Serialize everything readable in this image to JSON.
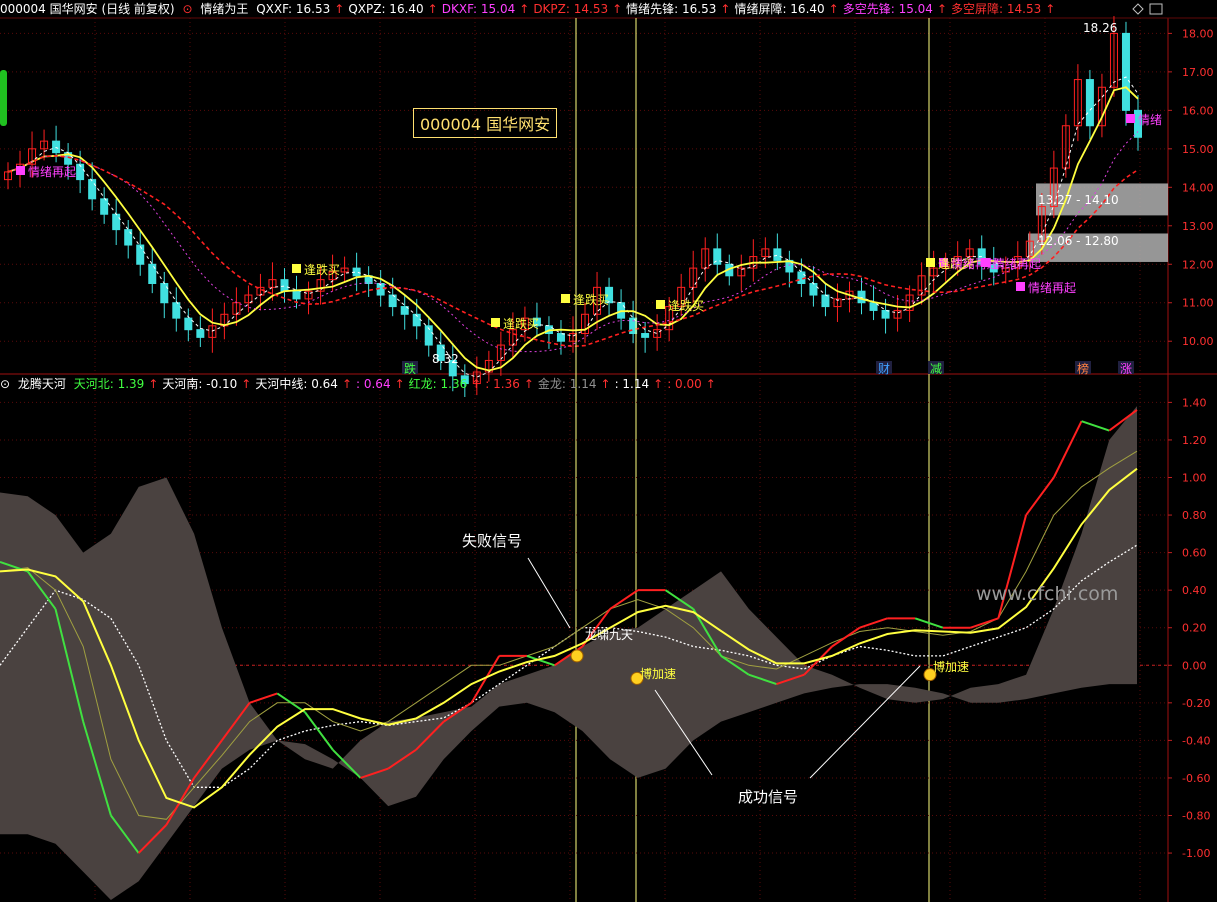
{
  "top_header": {
    "symbol": "000004 国华网安 (日线 前复权)",
    "indicator": "情绪为王",
    "items": [
      {
        "label": "QXXF: 16.53",
        "color": "#ffffff"
      },
      {
        "label": "QXPZ: 16.40",
        "color": "#ffffff"
      },
      {
        "label": "DKXF: 15.04",
        "color": "#ff40ff"
      },
      {
        "label": "DKPZ: 14.53",
        "color": "#ff3030"
      },
      {
        "label": "情绪先锋: 16.53",
        "color": "#ffffff"
      },
      {
        "label": "情绪屏障: 16.40",
        "color": "#ffffff"
      },
      {
        "label": "多空先锋: 15.04",
        "color": "#ff40ff"
      },
      {
        "label": "多空屏障: 14.53",
        "color": "#ff3030"
      }
    ]
  },
  "bottom_header": {
    "name": "龙腾天河",
    "items": [
      {
        "label": "天河北: 1.39",
        "color": "#40ff40"
      },
      {
        "label": "天河南: -0.10",
        "color": "#ffffff"
      },
      {
        "label": "天河中线: 0.64",
        "color": "#ffffff"
      },
      {
        "label": ": 0.64",
        "color": "#ff40ff"
      },
      {
        "label": "红龙: 1.36",
        "color": "#40ff40"
      },
      {
        "label": ": 1.36",
        "color": "#ff3030"
      },
      {
        "label": "金龙: 1.14",
        "color": "#909090"
      },
      {
        "label": ": 1.14",
        "color": "#ffffff"
      },
      {
        "label": ": 0.00",
        "color": "#ff3030"
      }
    ]
  },
  "stock_label": "000004 国华网安",
  "watermark": "www.cfchi.com",
  "annotations": {
    "fail_signal": "失败信号",
    "success_signal": "成功信号",
    "long_xiao": "龙啸九天",
    "bo_jiasu_1": "博加速",
    "bo_jiasu_2": "博加速",
    "price_high": "18.26",
    "price_low": "8.32",
    "zone_upper": "13.27 - 14.10",
    "zone_lower": "12.06 - 12.80"
  },
  "top_markers": [
    {
      "text": "情绪再起",
      "color": "#ff40ff"
    },
    {
      "text": "逢跌买",
      "color": "#ffff40"
    },
    {
      "text": "逢跌买",
      "color": "#ffff40"
    },
    {
      "text": "逢跌买",
      "color": "#ffff40"
    },
    {
      "text": "逢跌买",
      "color": "#ffff40"
    },
    {
      "text": "逢跌买",
      "color": "#ffff40"
    },
    {
      "text": "情绪再起",
      "color": "#ff40ff"
    },
    {
      "text": "情绪再起",
      "color": "#ff40ff"
    },
    {
      "text": "情绪再起",
      "color": "#ff40ff"
    },
    {
      "text": "情绪",
      "color": "#ff40ff"
    }
  ],
  "bottom_labels": [
    {
      "text": "跌",
      "color": "#40ff40"
    },
    {
      "text": "财",
      "color": "#40a0ff"
    },
    {
      "text": "减",
      "color": "#40ff40"
    },
    {
      "text": "榜",
      "color": "#ff8040"
    },
    {
      "text": "涨",
      "color": "#ff40ff"
    }
  ],
  "colors": {
    "up": "#ff2020",
    "down": "#40e0e0",
    "ma_white": "#ffffff",
    "ma_yellow": "#ffff40",
    "ma_red": "#ff2020",
    "ma_magenta": "#e040e0",
    "band": "#4a4240"
  },
  "chart_data": [
    {
      "type": "candlestick",
      "title": "000004 国华网安 (日线 前复权)",
      "ylim": [
        9.2,
        18.4
      ],
      "y_ticks": [
        10.0,
        11.0,
        12.0,
        13.0,
        14.0,
        15.0,
        16.0,
        17.0,
        18.0
      ],
      "close": [
        14.4,
        14.6,
        15.0,
        15.2,
        14.9,
        14.6,
        14.2,
        13.7,
        13.3,
        12.9,
        12.5,
        12.0,
        11.5,
        11.0,
        10.6,
        10.3,
        10.1,
        10.4,
        10.7,
        11.0,
        11.2,
        11.4,
        11.6,
        11.3,
        11.1,
        11.3,
        11.6,
        11.8,
        11.9,
        11.7,
        11.5,
        11.2,
        10.9,
        10.7,
        10.4,
        9.9,
        9.5,
        9.1,
        8.9,
        9.2,
        9.5,
        9.9,
        10.3,
        10.6,
        10.4,
        10.2,
        10.0,
        10.2,
        10.7,
        11.4,
        11.0,
        10.6,
        10.2,
        10.1,
        10.3,
        10.9,
        11.4,
        11.9,
        12.4,
        12.0,
        11.7,
        11.9,
        12.2,
        12.4,
        12.1,
        11.8,
        11.5,
        11.2,
        10.9,
        11.1,
        11.3,
        11.0,
        10.8,
        10.6,
        10.8,
        11.2,
        11.7,
        11.9,
        12.0,
        12.2,
        12.4,
        12.0,
        11.8,
        11.9,
        12.2,
        12.6,
        13.5,
        14.5,
        15.6,
        16.8,
        15.6,
        16.6,
        18.0,
        16.0,
        15.3
      ],
      "annotations": [
        "18.26",
        "8.32",
        "13.27 - 14.10",
        "12.06 - 12.80"
      ]
    },
    {
      "type": "line",
      "title": "龙腾天河",
      "ylim": [
        -1.25,
        1.45
      ],
      "y_ticks": [
        1.4,
        1.2,
        1.0,
        0.8,
        0.6,
        0.4,
        0.2,
        0.0,
        -0.2,
        -0.4,
        -0.6,
        -0.8,
        -1.0
      ],
      "series": [
        {
          "name": "天河北",
          "values": [
            0.92,
            0.9,
            0.8,
            0.6,
            0.7,
            0.95,
            1.0,
            0.7,
            0.2,
            -0.2,
            -0.4,
            -0.5,
            -0.55,
            -0.4,
            -0.3,
            -0.28,
            -0.25,
            -0.22,
            -0.1,
            -0.05,
            0.0,
            0.1,
            0.18,
            0.2,
            0.3,
            0.4,
            0.5,
            0.3,
            0.15,
            0.0,
            -0.05,
            -0.12,
            -0.18,
            -0.2,
            -0.18,
            -0.12,
            -0.1,
            -0.05,
            0.3,
            0.7,
            1.2,
            1.38
          ]
        },
        {
          "name": "天河南",
          "values": [
            -0.9,
            -0.9,
            -0.95,
            -1.1,
            -1.25,
            -1.15,
            -0.95,
            -0.75,
            -0.55,
            -0.45,
            -0.4,
            -0.42,
            -0.5,
            -0.6,
            -0.75,
            -0.7,
            -0.5,
            -0.35,
            -0.22,
            -0.2,
            -0.25,
            -0.35,
            -0.5,
            -0.6,
            -0.55,
            -0.4,
            -0.3,
            -0.25,
            -0.2,
            -0.15,
            -0.12,
            -0.1,
            -0.1,
            -0.12,
            -0.15,
            -0.2,
            -0.2,
            -0.18,
            -0.15,
            -0.12,
            -0.1,
            -0.1
          ]
        },
        {
          "name": "天河中线",
          "values": [
            0.0,
            0.2,
            0.4,
            0.35,
            0.25,
            0.0,
            -0.4,
            -0.65,
            -0.65,
            -0.55,
            -0.4,
            -0.35,
            -0.32,
            -0.3,
            -0.32,
            -0.3,
            -0.28,
            -0.2,
            -0.1,
            0.0,
            0.1,
            0.2,
            0.2,
            0.18,
            0.15,
            0.1,
            0.08,
            0.05,
            0.0,
            -0.02,
            0.05,
            0.1,
            0.08,
            0.05,
            0.05,
            0.1,
            0.15,
            0.2,
            0.3,
            0.45,
            0.55,
            0.64
          ]
        },
        {
          "name": "红龙",
          "values": [
            0.55,
            0.5,
            0.3,
            -0.3,
            -0.8,
            -1.0,
            -0.85,
            -0.6,
            -0.4,
            -0.2,
            -0.15,
            -0.25,
            -0.45,
            -0.6,
            -0.55,
            -0.45,
            -0.3,
            -0.2,
            0.05,
            0.05,
            0.0,
            0.1,
            0.3,
            0.4,
            0.4,
            0.3,
            0.05,
            -0.05,
            -0.1,
            -0.05,
            0.1,
            0.2,
            0.25,
            0.25,
            0.2,
            0.2,
            0.25,
            0.8,
            1.0,
            1.3,
            1.25,
            1.36
          ]
        },
        {
          "name": "金龙",
          "values": [
            0.5,
            0.52,
            0.4,
            0.1,
            -0.5,
            -0.8,
            -0.82,
            -0.65,
            -0.48,
            -0.3,
            -0.2,
            -0.2,
            -0.3,
            -0.35,
            -0.3,
            -0.2,
            -0.1,
            0.0,
            0.0,
            0.05,
            0.1,
            0.2,
            0.3,
            0.35,
            0.3,
            0.2,
            0.05,
            0.0,
            -0.02,
            0.05,
            0.12,
            0.18,
            0.2,
            0.18,
            0.16,
            0.18,
            0.25,
            0.5,
            0.8,
            0.95,
            1.05,
            1.14
          ]
        }
      ],
      "annotations": [
        "失败信号",
        "成功信号",
        "龙啸九天",
        "博加速",
        "博加速"
      ]
    }
  ]
}
